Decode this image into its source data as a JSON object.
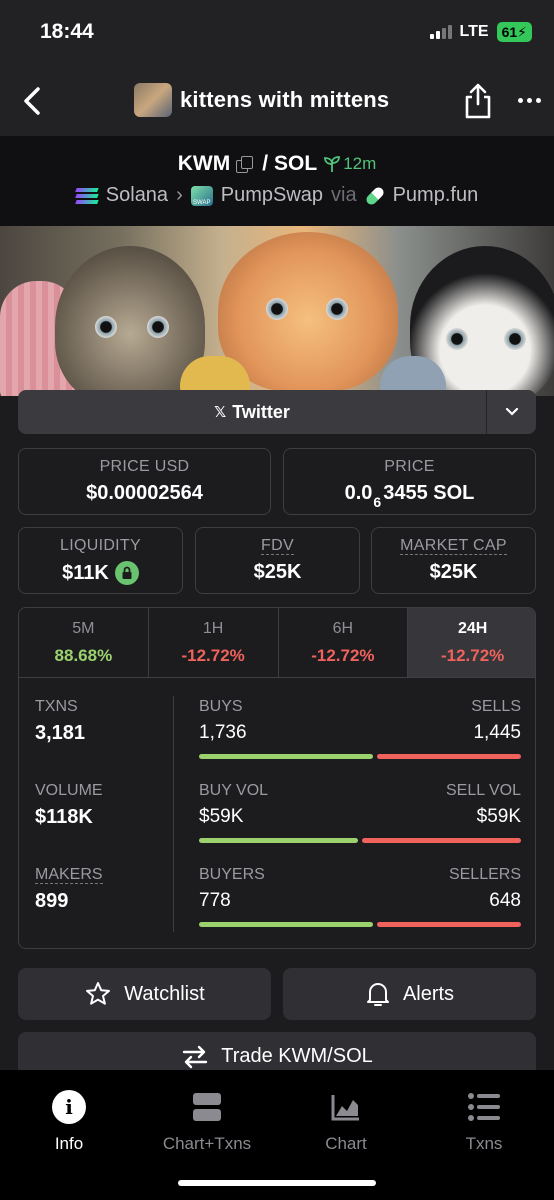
{
  "status": {
    "time": "18:44",
    "network": "LTE",
    "battery": "61"
  },
  "header": {
    "title": "kittens with mittens"
  },
  "pair": {
    "base": "KWM",
    "separator": "/",
    "quote": "SOL",
    "age": "12m",
    "chain": "Solana",
    "dex": "PumpSwap",
    "via": "via",
    "launchpad": "Pump.fun"
  },
  "social": {
    "twitter_label": "Twitter"
  },
  "price": {
    "usd_label": "PRICE USD",
    "usd_value": "$0.00002564",
    "native_label": "PRICE",
    "native_prefix": "0.0",
    "native_zeros": "6",
    "native_rest": "3455 SOL"
  },
  "metrics": {
    "liquidity_label": "LIQUIDITY",
    "liquidity_value": "$11K",
    "fdv_label": "FDV",
    "fdv_value": "$25K",
    "mcap_label": "MARKET CAP",
    "mcap_value": "$25K"
  },
  "timeframes": [
    {
      "label": "5M",
      "change": "88.68%",
      "color": "#9bd26e"
    },
    {
      "label": "1H",
      "change": "-12.72%",
      "color": "#f0625c"
    },
    {
      "label": "6H",
      "change": "-12.72%",
      "color": "#f0625c"
    },
    {
      "label": "24H",
      "change": "-12.72%",
      "color": "#f0625c"
    }
  ],
  "stats": {
    "txns_label": "TXNS",
    "txns_value": "3,181",
    "volume_label": "VOLUME",
    "volume_value": "$118K",
    "makers_label": "MAKERS",
    "makers_value": "899",
    "buys_label": "BUYS",
    "buys_value": "1,736",
    "sells_label": "SELLS",
    "sells_value": "1,445",
    "buys_ratio": 0.546,
    "buyvol_label": "BUY VOL",
    "buyvol_value": "$59K",
    "sellvol_label": "SELL VOL",
    "sellvol_value": "$59K",
    "buyvol_ratio": 0.5,
    "buyers_label": "BUYERS",
    "buyers_value": "778",
    "sellers_label": "SELLERS",
    "sellers_value": "648",
    "buyers_ratio": 0.546
  },
  "actions": {
    "watchlist": "Watchlist",
    "alerts": "Alerts",
    "trade": "Trade KWM/SOL"
  },
  "nav": [
    {
      "label": "Info",
      "icon": "info-icon"
    },
    {
      "label": "Chart+Txns",
      "icon": "chart-txns-icon"
    },
    {
      "label": "Chart",
      "icon": "chart-icon"
    },
    {
      "label": "Txns",
      "icon": "list-icon"
    }
  ],
  "colors": {
    "buy": "#9bd26e",
    "sell": "#f0625c",
    "age": "#52c27a"
  }
}
